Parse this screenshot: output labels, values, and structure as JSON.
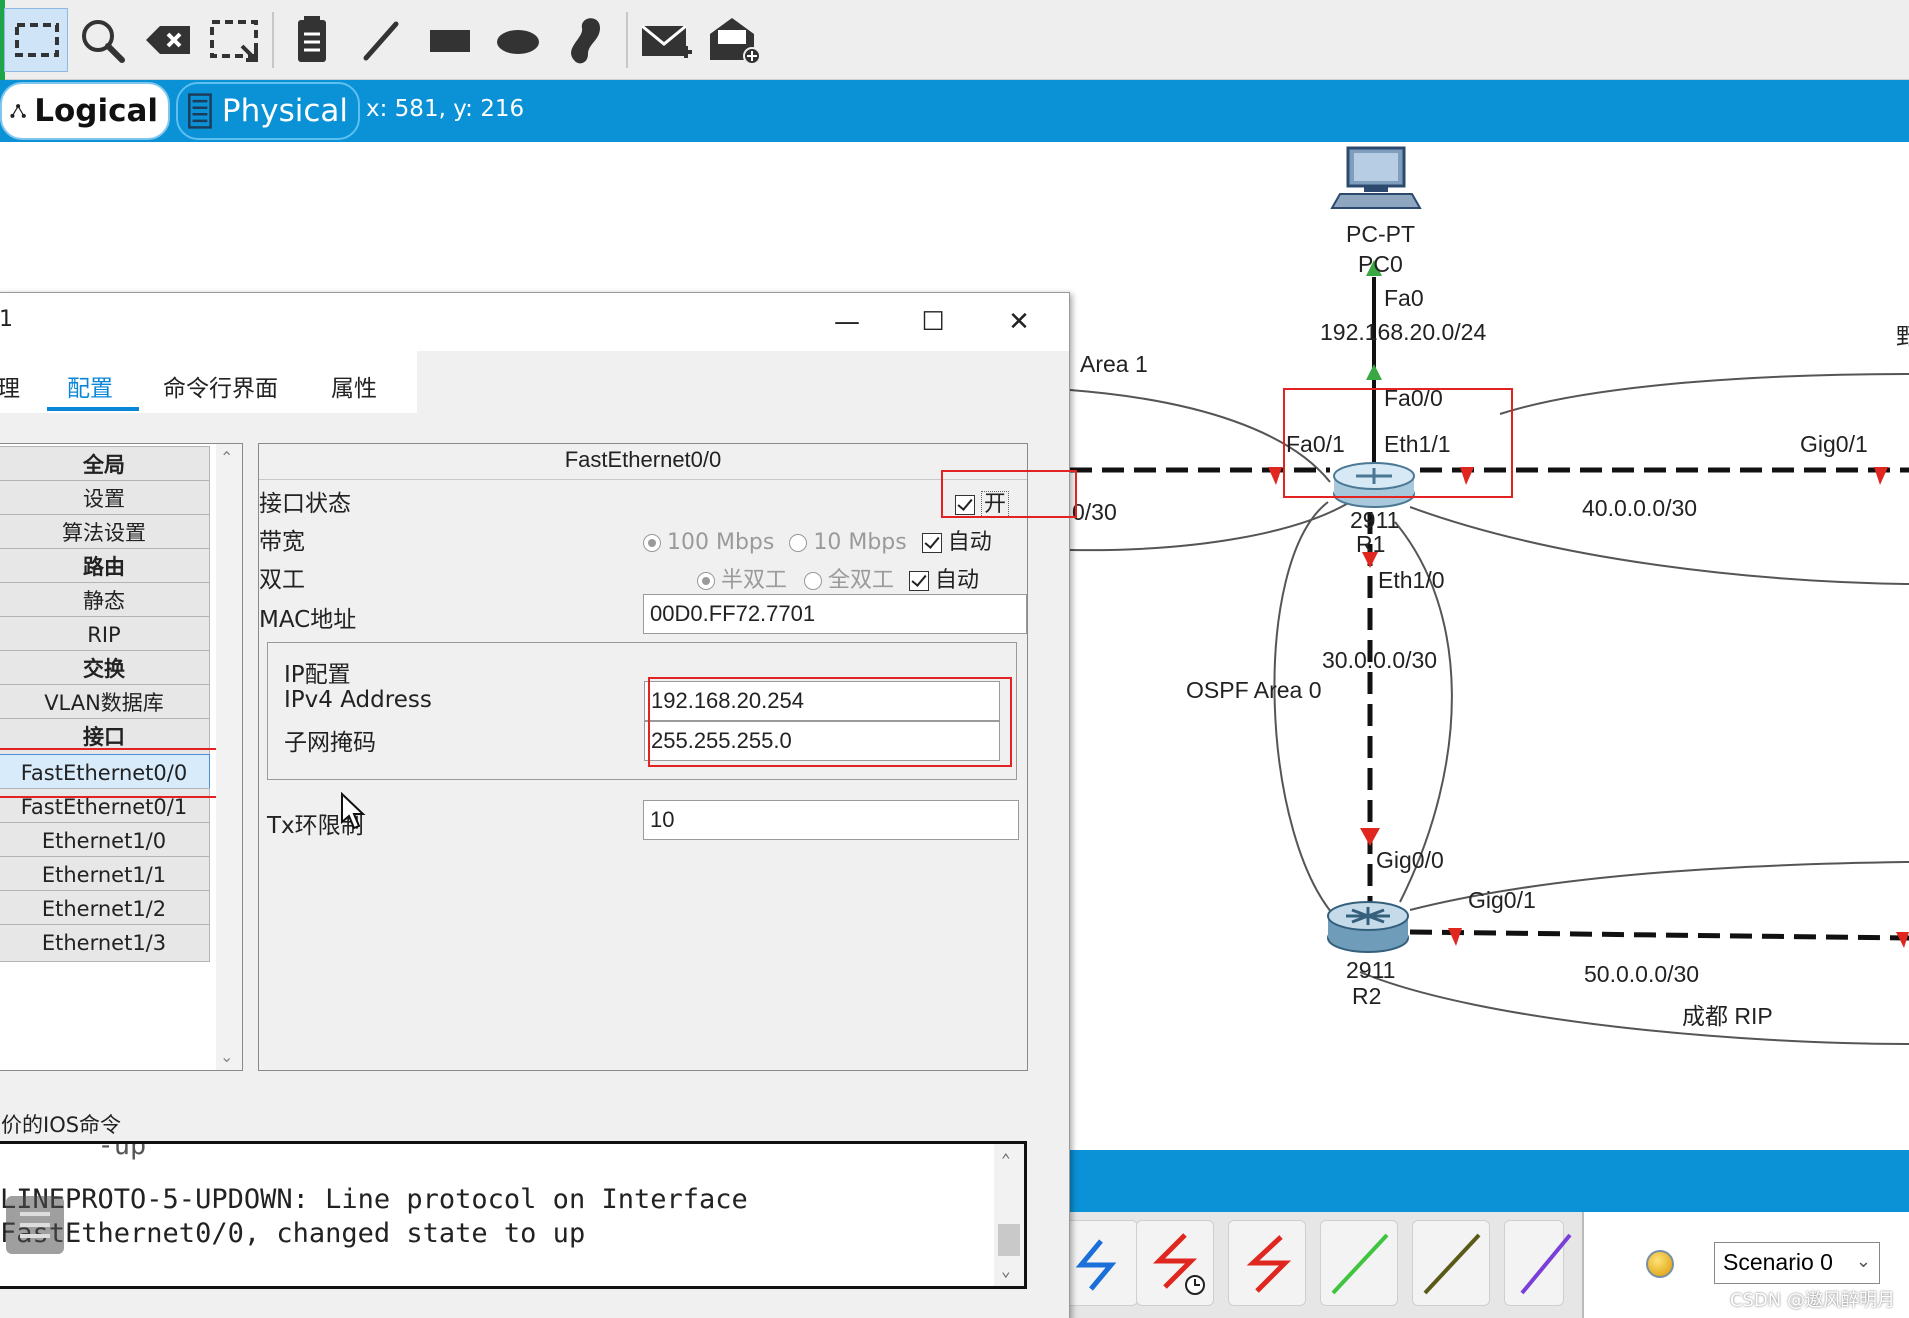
{
  "toolbar": {
    "icons": [
      "select-icon",
      "inspect-icon",
      "delete-icon",
      "resize-icon",
      "note-icon",
      "line-icon",
      "rectangle-icon",
      "ellipse-icon",
      "freeform-icon",
      "add-simple-pdu-icon",
      "add-complex-pdu-icon"
    ]
  },
  "modebar": {
    "logical_label": "Logical",
    "physical_label": "Physical",
    "coords": "x: 581, y: 216"
  },
  "topology": {
    "pc_model": "PC-PT",
    "pc_name": "PC0",
    "pc_port": "Fa0",
    "net_pc": "192.168.20.0/24",
    "area1": "Area 1",
    "r1_fa00": "Fa0/0",
    "r1_fa01": "Fa0/1",
    "r1_eth11": "Eth1/1",
    "r1_eth10": "Eth1/0",
    "r1_model": "2911",
    "r1_name": "R1",
    "gig01_right": "Gig0/1",
    "net_40": "40.0.0.0/30",
    "net_left": "0/30",
    "net_30": "30.0.0.0/30",
    "ospf_area0": "OSPF Area 0",
    "r2_gig00": "Gig0/0",
    "r2_gig01": "Gig0/1",
    "r2_model": "2911",
    "r2_name": "R2",
    "net_50": "50.0.0.0/30",
    "rip_label": "成都   RIP",
    "right_edge_char": "野"
  },
  "dialog": {
    "title": "1",
    "min": "—",
    "max": "☐",
    "close": "✕",
    "tabs": [
      "理",
      "配置",
      "命令行界面",
      "属性"
    ],
    "list": [
      {
        "label": "全局",
        "header": true
      },
      {
        "label": "设置",
        "header": false
      },
      {
        "label": "算法设置",
        "header": false
      },
      {
        "label": "路由",
        "header": true
      },
      {
        "label": "静态",
        "header": false
      },
      {
        "label": "RIP",
        "header": false
      },
      {
        "label": "交换",
        "header": true
      },
      {
        "label": "VLAN数据库",
        "header": false
      },
      {
        "label": "接口",
        "header": true
      },
      {
        "label": "FastEthernet0/0",
        "header": false
      },
      {
        "label": "FastEthernet0/1",
        "header": false
      },
      {
        "label": "Ethernet1/0",
        "header": false
      },
      {
        "label": "Ethernet1/1",
        "header": false
      },
      {
        "label": "Ethernet1/2",
        "header": false
      },
      {
        "label": "Ethernet1/3",
        "header": false
      }
    ],
    "panel_title": "FastEthernet0/0",
    "port_status_label": "接口状态",
    "port_status_on": "开",
    "bandwidth_label": "带宽",
    "bw_100": "100 Mbps",
    "bw_10": "10 Mbps",
    "auto": "自动",
    "duplex_label": "双工",
    "half_duplex": "半双工",
    "full_duplex": "全双工",
    "mac_label": "MAC地址",
    "mac_value": "00D0.FF72.7701",
    "ip_config_label": "IP配置",
    "ipv4_label": "IPv4 Address",
    "ipv4_value": "192.168.20.254",
    "mask_label": "子网掩码",
    "mask_value": "255.255.255.0",
    "tx_label": "Tx环限制",
    "tx_value": "10",
    "ios_label": "价的IOS命令",
    "console_lines": [
      "      -up",
      "LINEPROTO-5-UPDOWN: Line protocol on Interface",
      "FastEthernet0/0, changed state to up"
    ]
  },
  "bottom": {
    "scenario": "Scenario 0",
    "watermark": "CSDN @遨风醉明月"
  },
  "colors": {
    "accent_blue": "#0a91d6",
    "highlight_red": "#e32222",
    "link_red": "#e0271f",
    "link_green": "#3aa842"
  }
}
